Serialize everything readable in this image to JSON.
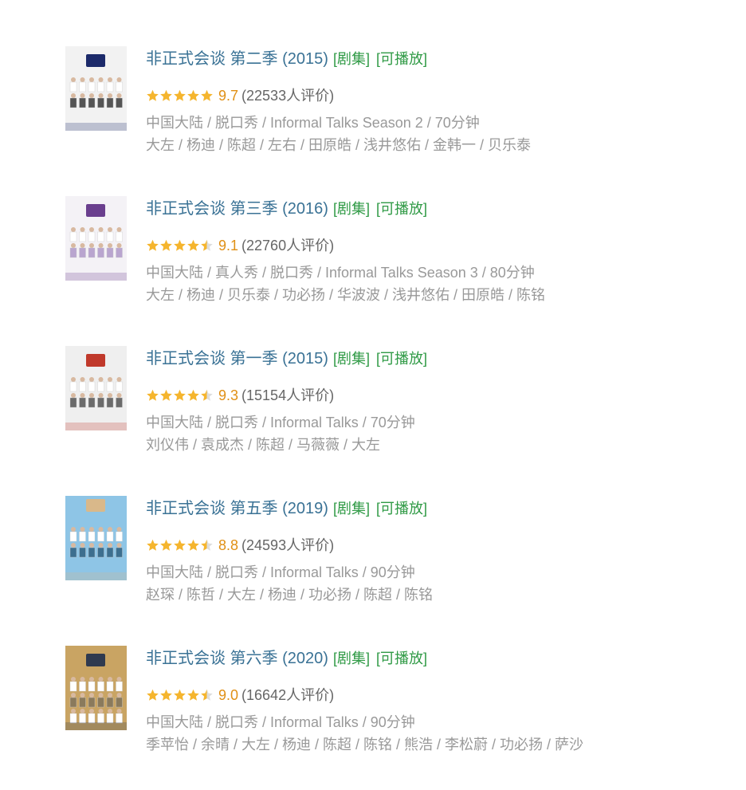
{
  "results": [
    {
      "title": "非正式会谈 第二季 (2015)",
      "tag_series": "[剧集]",
      "tag_playable": "[可播放]",
      "rating": "9.7",
      "stars": 5,
      "votes": "(22533人评价)",
      "meta": "中国大陆 / 脱口秀 / Informal Talks Season 2 / 70分钟",
      "cast": "大左 / 杨迪 / 陈超 / 左右 / 田原皓 / 浅井悠佑 / 金韩一 / 贝乐泰",
      "poster_colors": [
        "#f2f2f2",
        "#1c2a6a",
        "#555555"
      ]
    },
    {
      "title": "非正式会谈 第三季 (2016)",
      "tag_series": "[剧集]",
      "tag_playable": "[可播放]",
      "rating": "9.1",
      "stars": 4.5,
      "votes": "(22760人评价)",
      "meta": "中国大陆 / 真人秀 / 脱口秀 / Informal Talks Season 3 / 80分钟",
      "cast": "大左 / 杨迪 / 贝乐泰 / 功必扬 / 华波波 / 浅井悠佑 / 田原皓 / 陈铭",
      "poster_colors": [
        "#f4f2f6",
        "#6a3f8e",
        "#b9a5cf"
      ]
    },
    {
      "title": "非正式会谈 第一季 (2015)",
      "tag_series": "[剧集]",
      "tag_playable": "[可播放]",
      "rating": "9.3",
      "stars": 4.5,
      "votes": "(15154人评价)",
      "meta": "中国大陆 / 脱口秀 / Informal Talks / 70分钟",
      "cast": "刘仪伟 / 袁成杰 / 陈超 / 马薇薇 / 大左",
      "poster_colors": [
        "#efefef",
        "#c0392b",
        "#6b6b6b"
      ]
    },
    {
      "title": "非正式会谈 第五季 (2019)",
      "tag_series": "[剧集]",
      "tag_playable": "[可播放]",
      "rating": "8.8",
      "stars": 4.5,
      "votes": "(24593人评价)",
      "meta": "中国大陆 / 脱口秀 / Informal Talks / 90分钟",
      "cast": "赵琛 / 陈哲 / 大左 / 杨迪 / 功必扬 / 陈超 / 陈铭",
      "poster_colors": [
        "#8ec5e6",
        "#d9b88a",
        "#3d6f8f"
      ]
    },
    {
      "title": "非正式会谈 第六季 (2020)",
      "tag_series": "[剧集]",
      "tag_playable": "[可播放]",
      "rating": "9.0",
      "stars": 4.5,
      "votes": "(16642人评价)",
      "meta": "中国大陆 / 脱口秀 / Informal Talks / 90分钟",
      "cast": "季苹怡 / 余晴 / 大左 / 杨迪 / 陈超 / 陈铭 / 熊浩 / 李松蔚 / 功必扬 / 萨沙",
      "poster_colors": [
        "#c9a463",
        "#2f3a4f",
        "#8a7a5c"
      ]
    }
  ],
  "colors": {
    "title": "#3a7295",
    "tag": "#2f9a45",
    "star": "#f5b52e",
    "star_empty": "#dddddd",
    "score": "#e09015",
    "meta": "#999999"
  }
}
